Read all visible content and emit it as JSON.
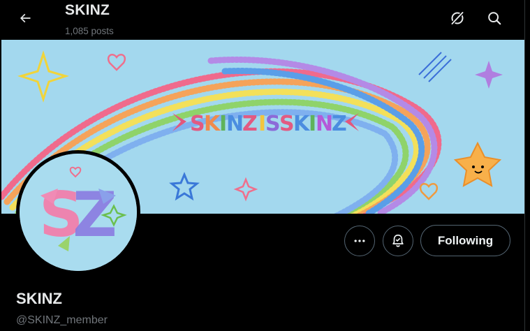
{
  "header": {
    "title": "SKINZ",
    "post_count": "1,085 posts",
    "back_icon": "arrow-left-icon",
    "grok_icon": "grok-icon",
    "search_icon": "search-icon"
  },
  "banner": {
    "wordmark": "SKINZ IS SKINZ",
    "background_color": "#9fd7ee"
  },
  "profile": {
    "display_name": "SKINZ",
    "handle": "@SKINZ_member",
    "avatar_letters": "SZ"
  },
  "actions": {
    "more_icon": "more-icon",
    "notify_icon": "notification-bell-icon",
    "following_label": "Following"
  },
  "colors": {
    "background": "#000000",
    "text_primary": "#e7e9ea",
    "text_secondary": "#71767b",
    "button_border": "#536471"
  }
}
